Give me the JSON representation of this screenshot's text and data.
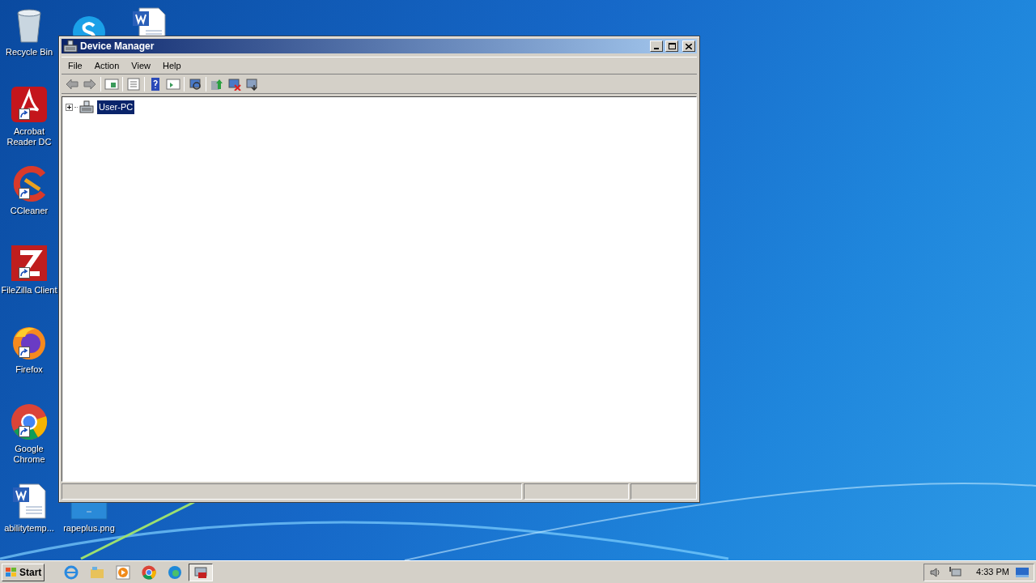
{
  "desktop_icons": [
    {
      "kind": "recycle",
      "label": "Recycle Bin"
    },
    {
      "kind": "skype"
    },
    {
      "kind": "word"
    },
    {
      "kind": "acrobat",
      "label": "Acrobat Reader DC",
      "shortcut": true
    },
    {
      "kind": "ccleaner",
      "label": "CCleaner",
      "shortcut": true
    },
    {
      "kind": "filezilla",
      "label": "FileZilla Client",
      "shortcut": true
    },
    {
      "kind": "firefox",
      "label": "Firefox",
      "shortcut": true
    },
    {
      "kind": "chrome",
      "label": "Google Chrome",
      "shortcut": true
    },
    {
      "kind": "word",
      "label": "abilitytemp..."
    },
    {
      "kind": "image",
      "label": "rapeplus.png"
    }
  ],
  "window": {
    "title": "Device Manager",
    "menu": [
      "File",
      "Action",
      "View",
      "Help"
    ],
    "tree": [
      {
        "label": "User-PC",
        "selected": true,
        "expanded": false
      }
    ]
  },
  "taskbar": {
    "start": "Start",
    "apps": [
      {
        "kind": "ie",
        "selected": false
      },
      {
        "kind": "explorer",
        "selected": false
      },
      {
        "kind": "media",
        "selected": false
      },
      {
        "kind": "chrome",
        "selected": false
      },
      {
        "kind": "edge",
        "selected": false
      },
      {
        "kind": "devmgr",
        "selected": true
      }
    ],
    "clock": "4:33 PM"
  }
}
